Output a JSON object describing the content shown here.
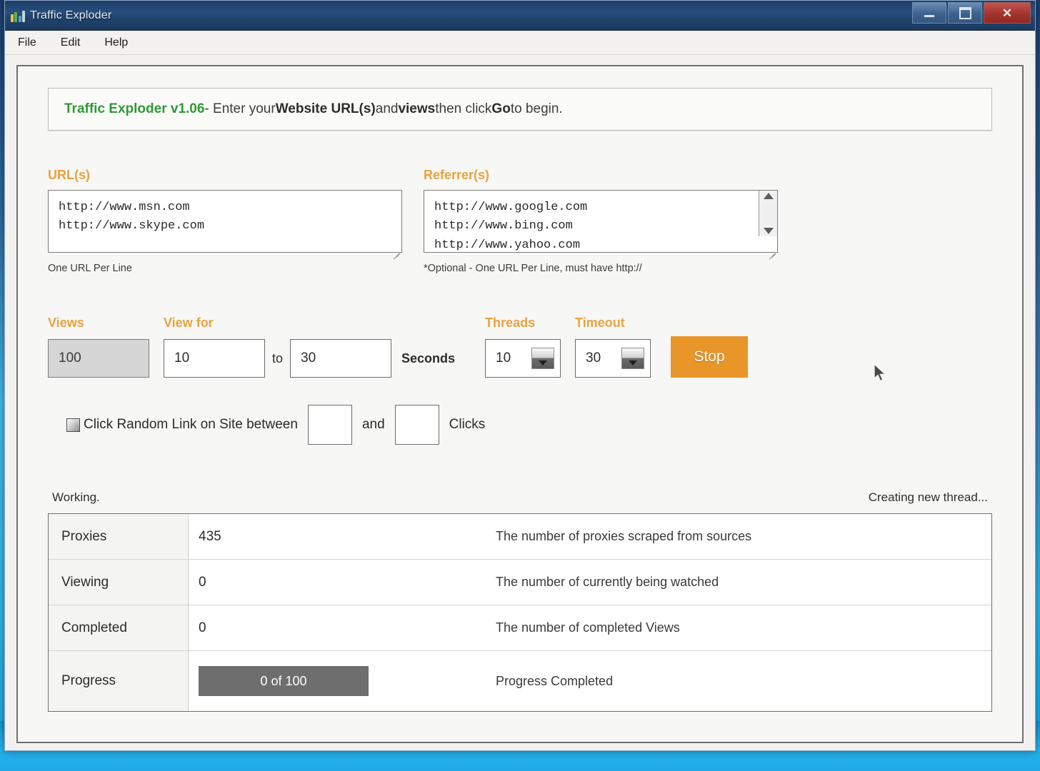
{
  "window": {
    "title": "Traffic Exploder",
    "icon": "bar-chart-icon",
    "buttons": {
      "minimize": "minimize-icon",
      "maximize": "maximize-icon",
      "close": "close-icon"
    }
  },
  "menubar": {
    "items": [
      {
        "label": "File"
      },
      {
        "label": "Edit"
      },
      {
        "label": "Help"
      }
    ]
  },
  "banner": {
    "version": "Traffic Exploder v1.06",
    "seg_dash": " - Enter your ",
    "bold1": "Website URL(s)",
    "seg_and": " and ",
    "bold2": "views",
    "seg_then": " then click ",
    "bold3": "Go",
    "seg_end": " to begin."
  },
  "urls": {
    "label": "URL(s)",
    "value": "http://www.msn.com\nhttp://www.skype.com",
    "placeholder": "",
    "hint": "One URL Per Line"
  },
  "referrers": {
    "label": "Referrer(s)",
    "value": "http://www.google.com\nhttp://www.bing.com\nhttp://www.yahoo.com",
    "placeholder": "",
    "hint": "*Optional - One URL Per Line, must have http://",
    "scrollbar_up": "scroll-up-icon",
    "scrollbar_down": "scroll-down-icon"
  },
  "controls": {
    "views_label": "Views",
    "views_value": "100",
    "viewfor_label": "View for",
    "viewfor_min": "10",
    "viewfor_to": "to",
    "viewfor_max": "30",
    "seconds_label": "Seconds",
    "threads_label": "Threads",
    "threads_value": "10",
    "timeout_label": "Timeout",
    "timeout_value": "30",
    "action_button": "Stop",
    "action_color": "#e8952a"
  },
  "random_click": {
    "label": "Click Random Link on Site between",
    "min_value": "",
    "and_label": "and",
    "max_value": "",
    "clicks_label": "Clicks",
    "checked": true
  },
  "status": {
    "left": "Working.",
    "right": "Creating new thread..."
  },
  "stats": {
    "rows": [
      {
        "label": "Proxies",
        "value": "435",
        "desc": "The number of proxies scraped from sources"
      },
      {
        "label": "Viewing",
        "value": "0",
        "desc": "The number of currently being watched"
      },
      {
        "label": "Completed",
        "value": "0",
        "desc": "The number of completed Views"
      }
    ],
    "progress": {
      "label": "Progress",
      "value": "0 of 100",
      "desc": "Progress Completed",
      "percent": 0,
      "bar_color": "#6e6e6e"
    }
  },
  "theme": {
    "accent_orange": "#e8a33d",
    "version_green": "#2e9a34",
    "titlebar_blue": "#20436e",
    "close_red": "#a4342c"
  }
}
